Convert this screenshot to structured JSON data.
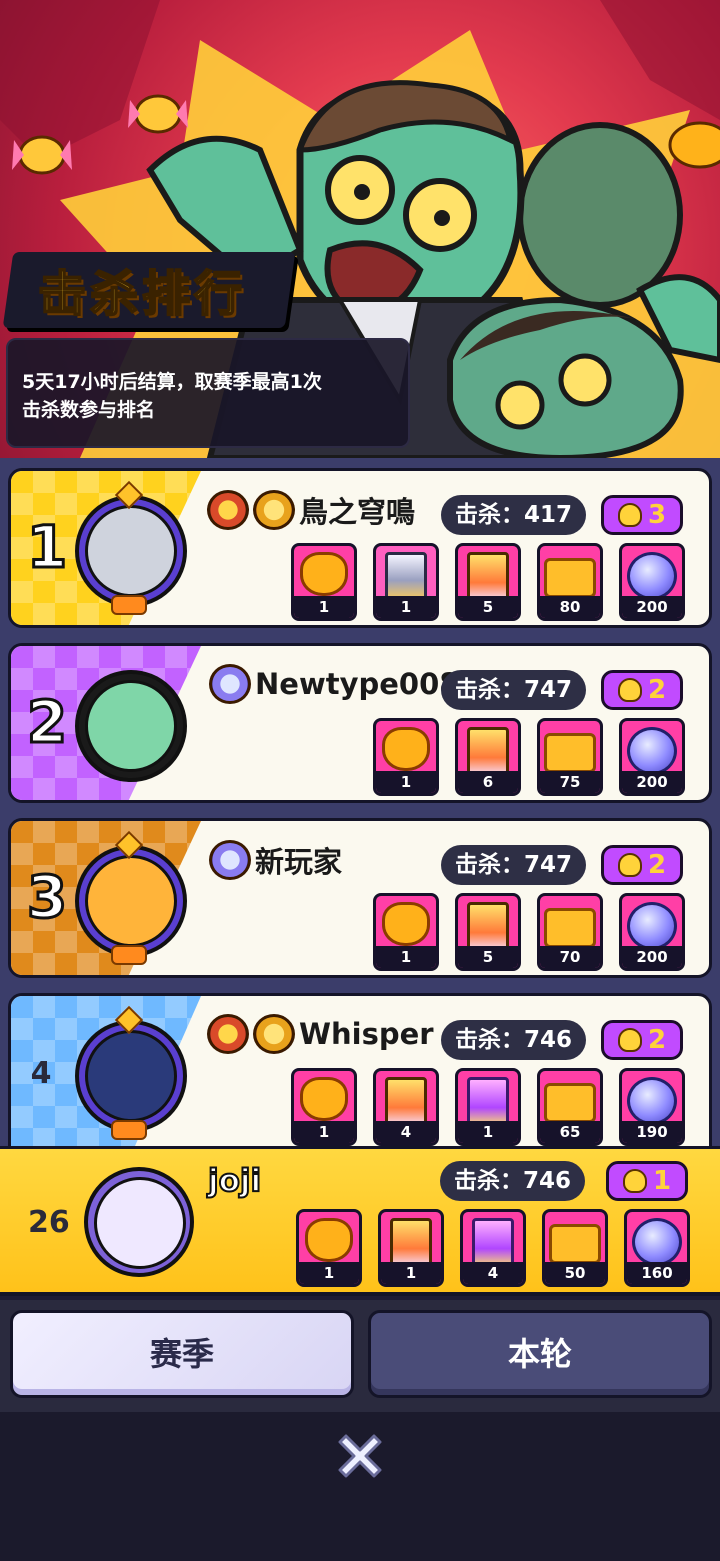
{
  "header": {
    "title": "击杀排行",
    "info_line1": "5天17小时后结算，取赛季最高1次",
    "info_line2": "击杀数参与排名"
  },
  "kill_label": "击杀：",
  "rows": [
    {
      "rank": "1",
      "name": "鳥之穹鳴",
      "kills": "417",
      "skull_count": "3",
      "stripe_color": "#ffd21e",
      "avatar_color": "#cfd3dd",
      "medals": [
        "red-medal-icon",
        "gold-medal-icon"
      ],
      "rewards": [
        {
          "icon": "trophy-icon",
          "count": "1"
        },
        {
          "icon": "silver-card-pack-icon",
          "count": "1"
        },
        {
          "icon": "gold-card-pack-icon",
          "count": "5"
        },
        {
          "icon": "ticket-icon",
          "count": "80"
        },
        {
          "icon": "gem-orb-icon",
          "count": "200"
        }
      ]
    },
    {
      "rank": "2",
      "name": "Newtype008",
      "kills": "747",
      "skull_count": "2",
      "stripe_color": "#c262ff",
      "avatar_color": "#7fd6a8",
      "medals": [
        "purple-medal-icon"
      ],
      "rewards": [
        {
          "icon": "trophy-icon",
          "count": "1"
        },
        {
          "icon": "gold-card-pack-icon",
          "count": "6"
        },
        {
          "icon": "ticket-icon",
          "count": "75"
        },
        {
          "icon": "gem-orb-icon",
          "count": "200"
        }
      ]
    },
    {
      "rank": "3",
      "name": "新玩家",
      "kills": "747",
      "skull_count": "2",
      "stripe_color": "#e08a1c",
      "avatar_color": "#ffb43a",
      "medals": [
        "purple-medal-icon"
      ],
      "rewards": [
        {
          "icon": "trophy-icon",
          "count": "1"
        },
        {
          "icon": "gold-card-pack-icon",
          "count": "5"
        },
        {
          "icon": "ticket-icon",
          "count": "70"
        },
        {
          "icon": "gem-orb-icon",
          "count": "200"
        }
      ]
    },
    {
      "rank": "4",
      "name": "Whisper",
      "kills": "746",
      "skull_count": "2",
      "stripe_color": "#6fb9ff",
      "avatar_color": "#2a3a7a",
      "medals": [
        "red-medal-icon",
        "gold-medal-icon"
      ],
      "rewards": [
        {
          "icon": "trophy-icon",
          "count": "1"
        },
        {
          "icon": "gold-card-pack-icon",
          "count": "4"
        },
        {
          "icon": "purple-card-pack-icon",
          "count": "1"
        },
        {
          "icon": "ticket-icon",
          "count": "65"
        },
        {
          "icon": "gem-orb-icon",
          "count": "190"
        }
      ]
    }
  ],
  "me": {
    "rank": "26",
    "name": "joji",
    "kills": "746",
    "skull_count": "1",
    "rewards": [
      {
        "icon": "trophy-icon",
        "count": "1"
      },
      {
        "icon": "gold-card-pack-icon",
        "count": "1"
      },
      {
        "icon": "purple-card-pack-icon",
        "count": "4"
      },
      {
        "icon": "ticket-icon",
        "count": "50"
      },
      {
        "icon": "gem-orb-icon",
        "count": "160"
      }
    ]
  },
  "tabs": {
    "season": "赛季",
    "round": "本轮"
  }
}
